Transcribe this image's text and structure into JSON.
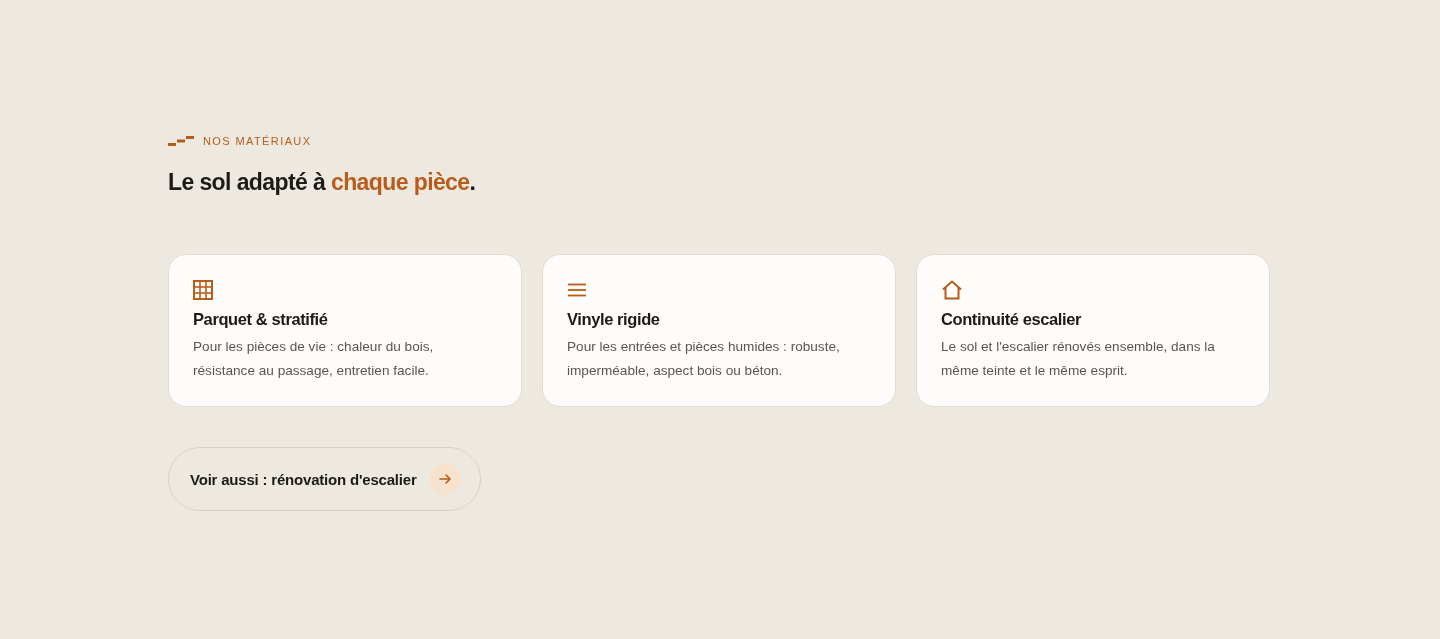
{
  "section": {
    "eyebrow": "NOS MATÉRIAUX",
    "heading": [
      {
        "text": "Le sol adapté à ",
        "accent": false
      },
      {
        "text": "chaque pièce",
        "accent": true
      },
      {
        "text": ".",
        "accent": false
      }
    ]
  },
  "cards": [
    {
      "title": "Parquet & stratifié",
      "description": "Pour les pièces de vie : chaleur du bois, résistance au passage, entretien facile."
    },
    {
      "title": "Vinyle rigide",
      "description": "Pour les entrées et pièces humides : robuste, imperméable, aspect bois ou béton."
    },
    {
      "title": "Continuité escalier",
      "description": "Le sol et l'escalier rénovés ensemble, dans la même teinte et le même esprit."
    }
  ],
  "link_button": {
    "label": "Voir aussi : rénovation d'escalier"
  }
}
